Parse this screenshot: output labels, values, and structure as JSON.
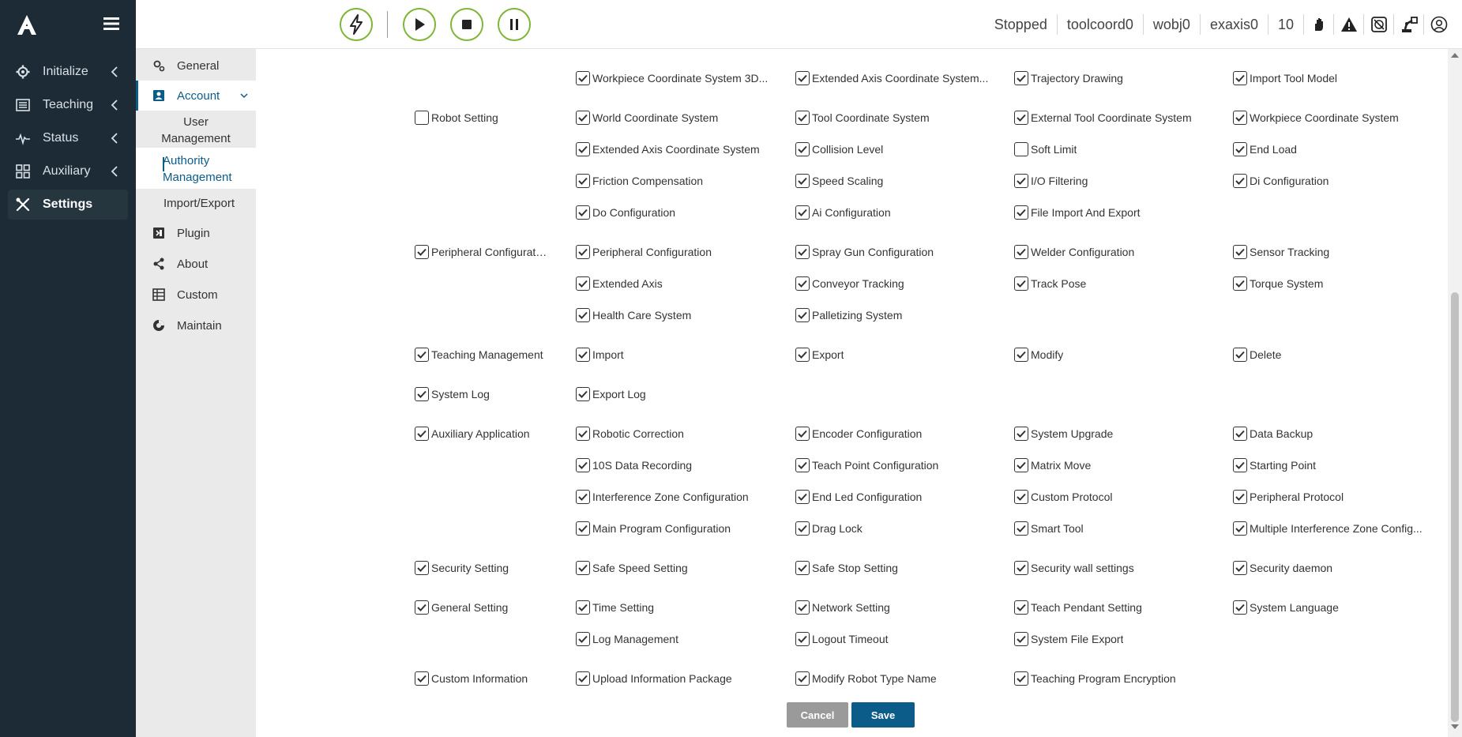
{
  "sidebar": {
    "items": [
      {
        "label": "Initialize",
        "icon": "gear-icon"
      },
      {
        "label": "Teaching",
        "icon": "list-icon"
      },
      {
        "label": "Status",
        "icon": "pulse-icon"
      },
      {
        "label": "Auxiliary",
        "icon": "grid-icon"
      },
      {
        "label": "Settings",
        "icon": "tools-icon"
      }
    ]
  },
  "toolbar": {
    "buttons": [
      "lightning-icon",
      "play-icon",
      "stop-icon",
      "pause-icon"
    ],
    "status": [
      "Stopped",
      "toolcoord0",
      "wobj0",
      "exaxis0",
      "10"
    ],
    "status_icons": [
      "hand-icon",
      "warning-icon",
      "no-touch-icon",
      "robot-arm-icon",
      "user-circle-icon"
    ]
  },
  "submenu": {
    "general": "General",
    "account": "Account",
    "user_management_1": "User",
    "user_management_2": "Management",
    "authority_management_1": "Authority",
    "authority_management_2": "Management",
    "import_export": "Import/Export",
    "plugin": "Plugin",
    "about": "About",
    "custom": "Custom",
    "maintain": "Maintain"
  },
  "permissions": {
    "rows": [
      {
        "category": null,
        "items": [
          [
            "Workpiece Coordinate System 3D...",
            true
          ],
          [
            "Extended Axis Coordinate System...",
            true
          ],
          [
            "Trajectory Drawing",
            true
          ],
          [
            "Import Tool Model",
            true
          ]
        ]
      },
      {
        "category": [
          "Robot Setting",
          false
        ],
        "items": [
          [
            "World Coordinate System",
            true
          ],
          [
            "Tool Coordinate System",
            true
          ],
          [
            "External Tool Coordinate System",
            true
          ],
          [
            "Workpiece Coordinate System",
            true
          ]
        ]
      },
      {
        "category": null,
        "items": [
          [
            "Extended Axis Coordinate System",
            true
          ],
          [
            "Collision Level",
            true
          ],
          [
            "Soft Limit",
            false
          ],
          [
            "End Load",
            true
          ]
        ]
      },
      {
        "category": null,
        "items": [
          [
            "Friction Compensation",
            true
          ],
          [
            "Speed Scaling",
            true
          ],
          [
            "I/O Filtering",
            true
          ],
          [
            "Di Configuration",
            true
          ]
        ]
      },
      {
        "category": null,
        "items": [
          [
            "Do Configuration",
            true
          ],
          [
            "Ai Configuration",
            true
          ],
          [
            "File Import And Export",
            true
          ]
        ]
      },
      {
        "category": [
          "Peripheral Configuration",
          true
        ],
        "items": [
          [
            "Peripheral Configuration",
            true
          ],
          [
            "Spray Gun Configuration",
            true
          ],
          [
            "Welder Configuration",
            true
          ],
          [
            "Sensor Tracking",
            true
          ]
        ]
      },
      {
        "category": null,
        "items": [
          [
            "Extended Axis",
            true
          ],
          [
            "Conveyor Tracking",
            true
          ],
          [
            "Track Pose",
            true
          ],
          [
            "Torque System",
            true
          ]
        ]
      },
      {
        "category": null,
        "items": [
          [
            "Health Care System",
            true
          ],
          [
            "Palletizing System",
            true
          ]
        ]
      },
      {
        "category": [
          "Teaching Management",
          true
        ],
        "items": [
          [
            "Import",
            true
          ],
          [
            "Export",
            true
          ],
          [
            "Modify",
            true
          ],
          [
            "Delete",
            true
          ]
        ]
      },
      {
        "category": [
          "System Log",
          true
        ],
        "items": [
          [
            "Export Log",
            true
          ]
        ]
      },
      {
        "category": [
          "Auxiliary Application",
          true
        ],
        "items": [
          [
            "Robotic Correction",
            true
          ],
          [
            "Encoder Configuration",
            true
          ],
          [
            "System Upgrade",
            true
          ],
          [
            "Data Backup",
            true
          ]
        ]
      },
      {
        "category": null,
        "items": [
          [
            "10S Data Recording",
            true
          ],
          [
            "Teach Point Configuration",
            true
          ],
          [
            "Matrix Move",
            true
          ],
          [
            "Starting Point",
            true
          ]
        ]
      },
      {
        "category": null,
        "items": [
          [
            "Interference Zone Configuration",
            true
          ],
          [
            "End Led Configuration",
            true
          ],
          [
            "Custom Protocol",
            true
          ],
          [
            "Peripheral Protocol",
            true
          ]
        ]
      },
      {
        "category": null,
        "items": [
          [
            "Main Program Configuration",
            true
          ],
          [
            "Drag Lock",
            true
          ],
          [
            "Smart Tool",
            true
          ],
          [
            "Multiple Interference Zone Config...",
            true
          ]
        ]
      },
      {
        "category": [
          "Security Setting",
          true
        ],
        "items": [
          [
            "Safe Speed Setting",
            true
          ],
          [
            "Safe Stop Setting",
            true
          ],
          [
            "Security wall settings",
            true
          ],
          [
            "Security daemon",
            true
          ]
        ]
      },
      {
        "category": [
          "General Setting",
          true
        ],
        "items": [
          [
            "Time Setting",
            true
          ],
          [
            "Network Setting",
            true
          ],
          [
            "Teach Pendant Setting",
            true
          ],
          [
            "System Language",
            true
          ]
        ]
      },
      {
        "category": null,
        "items": [
          [
            "Log Management",
            true
          ],
          [
            "Logout Timeout",
            true
          ],
          [
            "System File Export",
            true
          ]
        ]
      },
      {
        "category": [
          "Custom Information",
          true
        ],
        "items": [
          [
            "Upload Information Package",
            true
          ],
          [
            "Modify Robot Type Name",
            true
          ],
          [
            "Teaching Program Encryption",
            true
          ]
        ]
      }
    ]
  },
  "actions": {
    "cancel": "Cancel",
    "save": "Save"
  },
  "colors": {
    "sidebar_bg": "#1c2b36",
    "accent_green": "#7fb539",
    "primary_blue": "#0c5c8a",
    "cancel_gray": "#9a9a9a"
  }
}
